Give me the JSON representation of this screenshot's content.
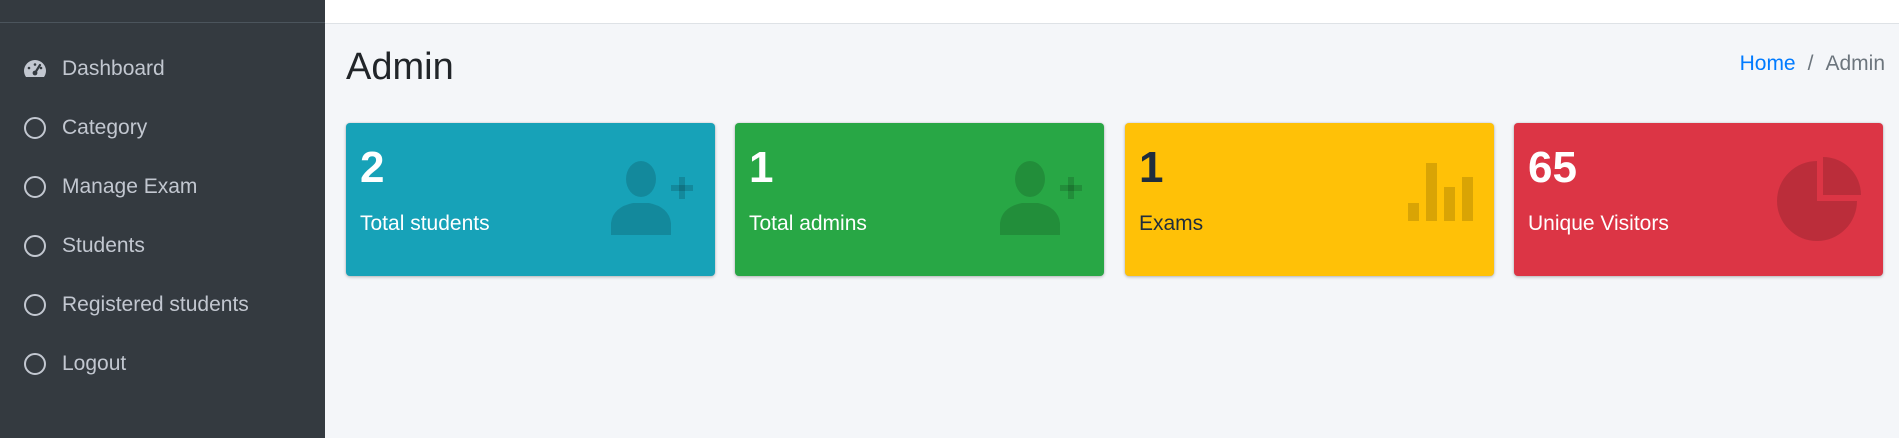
{
  "sidebar": {
    "items": [
      {
        "label": "Dashboard",
        "icon": "tachometer-icon"
      },
      {
        "label": "Category",
        "icon": "circle-icon"
      },
      {
        "label": "Manage Exam",
        "icon": "circle-icon"
      },
      {
        "label": "Students",
        "icon": "circle-icon"
      },
      {
        "label": "Registered students",
        "icon": "circle-icon"
      },
      {
        "label": "Logout",
        "icon": "circle-icon"
      }
    ]
  },
  "header": {
    "title": "Admin",
    "breadcrumb": {
      "home": "Home",
      "separator": "/",
      "current": "Admin"
    }
  },
  "stats": [
    {
      "value": "2",
      "label": "Total students",
      "color": "#17a2b8",
      "icon": "user-plus-icon"
    },
    {
      "value": "1",
      "label": "Total admins",
      "color": "#28a745",
      "icon": "user-plus-icon"
    },
    {
      "value": "1",
      "label": "Exams",
      "color": "#ffc107",
      "icon": "bar-chart-icon"
    },
    {
      "value": "65",
      "label": "Unique Visitors",
      "color": "#dc3545",
      "icon": "pie-chart-icon"
    }
  ],
  "colors": {
    "sidebar_bg": "#343a40",
    "content_bg": "#f4f6f9",
    "link": "#007bff"
  }
}
